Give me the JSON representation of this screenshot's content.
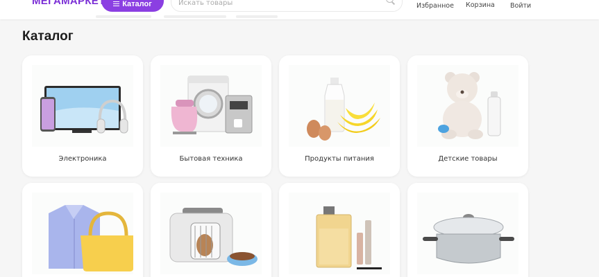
{
  "header": {
    "logo_text": "МЕГАМАРКЕТ",
    "catalog_button": "Каталог",
    "search_placeholder": "Искать товары",
    "nav": {
      "favorites": "Избранное",
      "cart": "Корзина",
      "login": "Войти"
    }
  },
  "page": {
    "title": "Каталог"
  },
  "categories": [
    {
      "label": "Электроника",
      "icon": "electronics-image"
    },
    {
      "label": "Бытовая техника",
      "icon": "appliances-image"
    },
    {
      "label": "Продукты питания",
      "icon": "food-image"
    },
    {
      "label": "Детские товары",
      "icon": "kids-goods-image"
    },
    {
      "label": "",
      "icon": "clothing-image"
    },
    {
      "label": "",
      "icon": "pet-supplies-image"
    },
    {
      "label": "",
      "icon": "beauty-image"
    },
    {
      "label": "",
      "icon": "home-kitchen-image"
    }
  ],
  "colors": {
    "brand": "#8b3fe2",
    "logo": "#7b2fd6",
    "logo_accent": "#52c41a",
    "background": "#f6f6f6",
    "card": "#ffffff"
  }
}
